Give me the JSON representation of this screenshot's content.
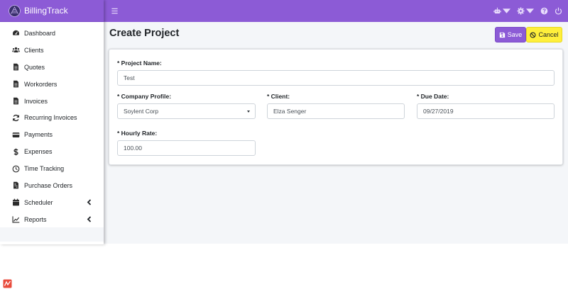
{
  "brand": {
    "name": "BillingTrack"
  },
  "sidebar": {
    "items": [
      {
        "label": "Dashboard",
        "icon": "tachometer-icon",
        "has_submenu": false
      },
      {
        "label": "Clients",
        "icon": "users-icon",
        "has_submenu": false
      },
      {
        "label": "Quotes",
        "icon": "file-text-icon",
        "has_submenu": false
      },
      {
        "label": "Workorders",
        "icon": "file-text-icon",
        "has_submenu": false
      },
      {
        "label": "Invoices",
        "icon": "file-text-icon",
        "has_submenu": false
      },
      {
        "label": "Recurring Invoices",
        "icon": "sync-icon",
        "has_submenu": false
      },
      {
        "label": "Payments",
        "icon": "credit-card-icon",
        "has_submenu": false
      },
      {
        "label": "Expenses",
        "icon": "dollar-icon",
        "has_submenu": false
      },
      {
        "label": "Time Tracking",
        "icon": "clock-icon",
        "has_submenu": false
      },
      {
        "label": "Purchase Orders",
        "icon": "file-invoice-icon",
        "has_submenu": false
      },
      {
        "label": "Scheduler",
        "icon": "calendar-icon",
        "has_submenu": true
      },
      {
        "label": "Reports",
        "icon": "chart-line-icon",
        "has_submenu": true
      }
    ]
  },
  "topbar": {
    "icons": [
      "menu-icon",
      "robot-icon",
      "gear-icon",
      "help-icon",
      "power-icon"
    ]
  },
  "page": {
    "title": "Create Project",
    "save_label": "Save",
    "cancel_label": "Cancel"
  },
  "form": {
    "project_name": {
      "label": "* Project Name:",
      "value": "Test"
    },
    "company_profile": {
      "label": "* Company Profile:",
      "value": "Soylent Corp"
    },
    "client": {
      "label": "* Client:",
      "value": "Elza Senger"
    },
    "due_date": {
      "label": "* Due Date:",
      "value": "09/27/2019"
    },
    "hourly_rate": {
      "label": "* Hourly Rate:",
      "value": "100.00"
    }
  },
  "colors": {
    "accent": "#8c5bd6",
    "cancel": "#ffef3b",
    "background": "#f4f6f9"
  }
}
